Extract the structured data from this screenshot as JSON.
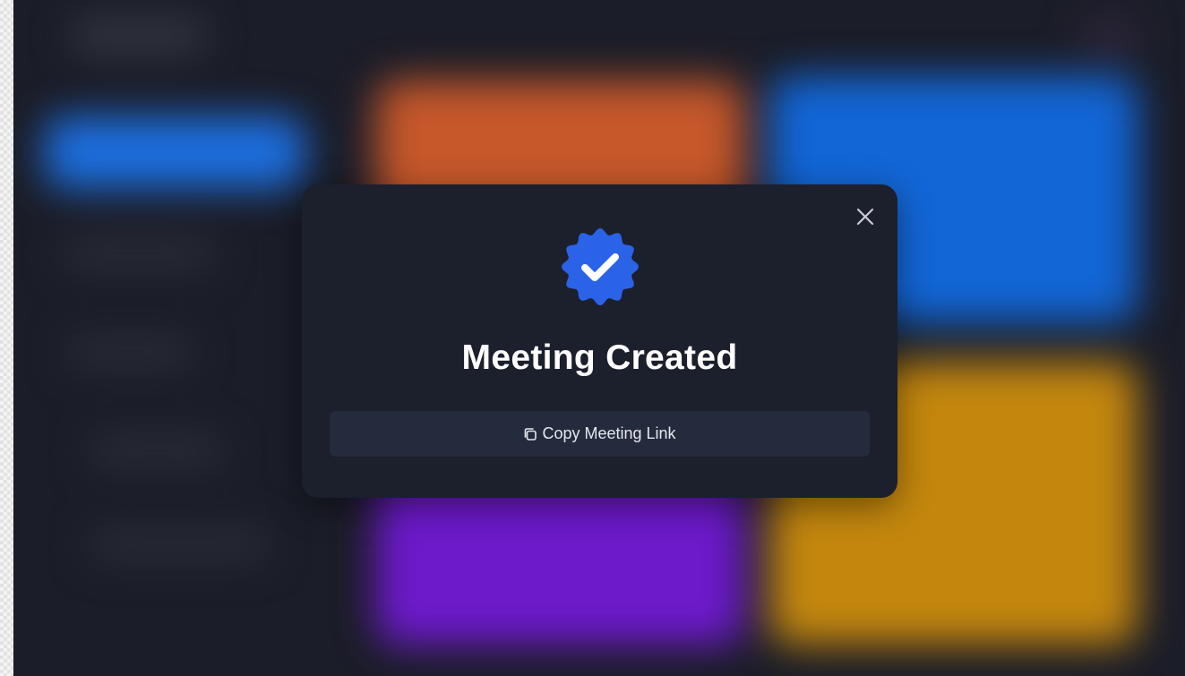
{
  "modal": {
    "title": "Meeting Created",
    "copy_button_label": "Copy Meeting Link",
    "badge_icon": "verified-check-icon",
    "close_icon": "close-icon",
    "copy_icon": "copy-icon"
  },
  "colors": {
    "badge": "#2a63e8",
    "modal_bg": "#1c1f2c",
    "button_bg": "#232b3c",
    "tile_orange": "#c6582a",
    "tile_blue": "#1266d6",
    "tile_purple": "#6d1acb",
    "tile_yellow": "#c4870e",
    "sidebar_active": "#1c6fe0"
  }
}
